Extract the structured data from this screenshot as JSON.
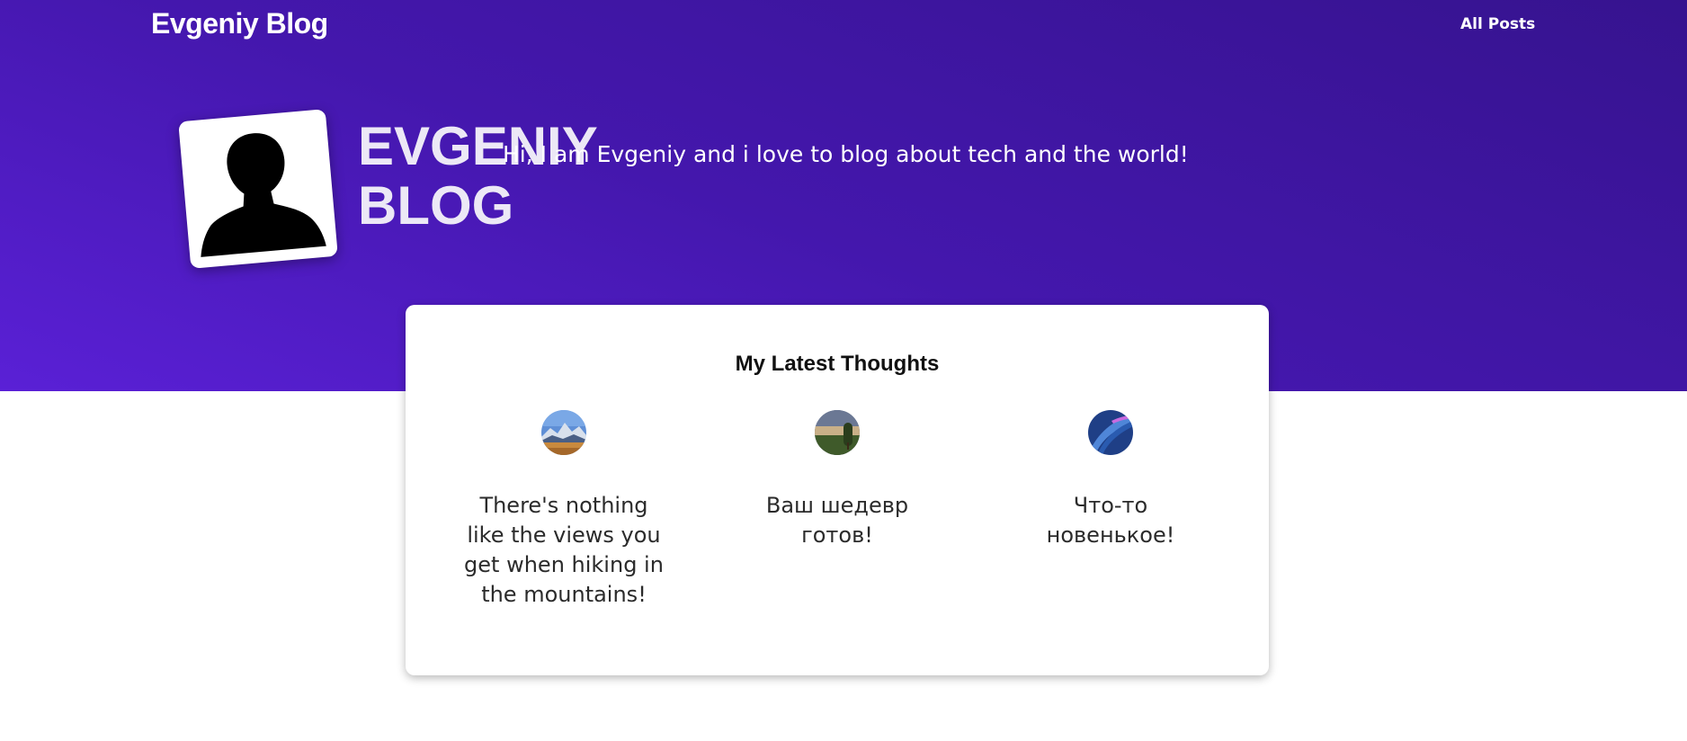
{
  "header": {
    "site_title": "Evgeniy Blog",
    "nav": [
      {
        "label": "All Posts"
      }
    ]
  },
  "hero": {
    "title": "EVGENIY BLOG",
    "tagline": "Hi, I am Evgeniy and i love to blog about tech and the world!",
    "avatar_icon": "person-silhouette-icon"
  },
  "latest": {
    "heading": "My Latest Thoughts",
    "posts": [
      {
        "title": "There's nothing like the views you get when hiking in the mountains!",
        "thumb": "mountains-thumbnail"
      },
      {
        "title": "Ваш шедевр готов!",
        "thumb": "landscape-tree-thumbnail"
      },
      {
        "title": "Что-то новенькое!",
        "thumb": "abstract-blue-thumbnail"
      }
    ]
  },
  "colors": {
    "hero_gradient_dark": "#36138f",
    "hero_gradient_light": "#5a20d6",
    "panel_bg": "#ffffff",
    "text_dark": "#2b2b2b"
  }
}
